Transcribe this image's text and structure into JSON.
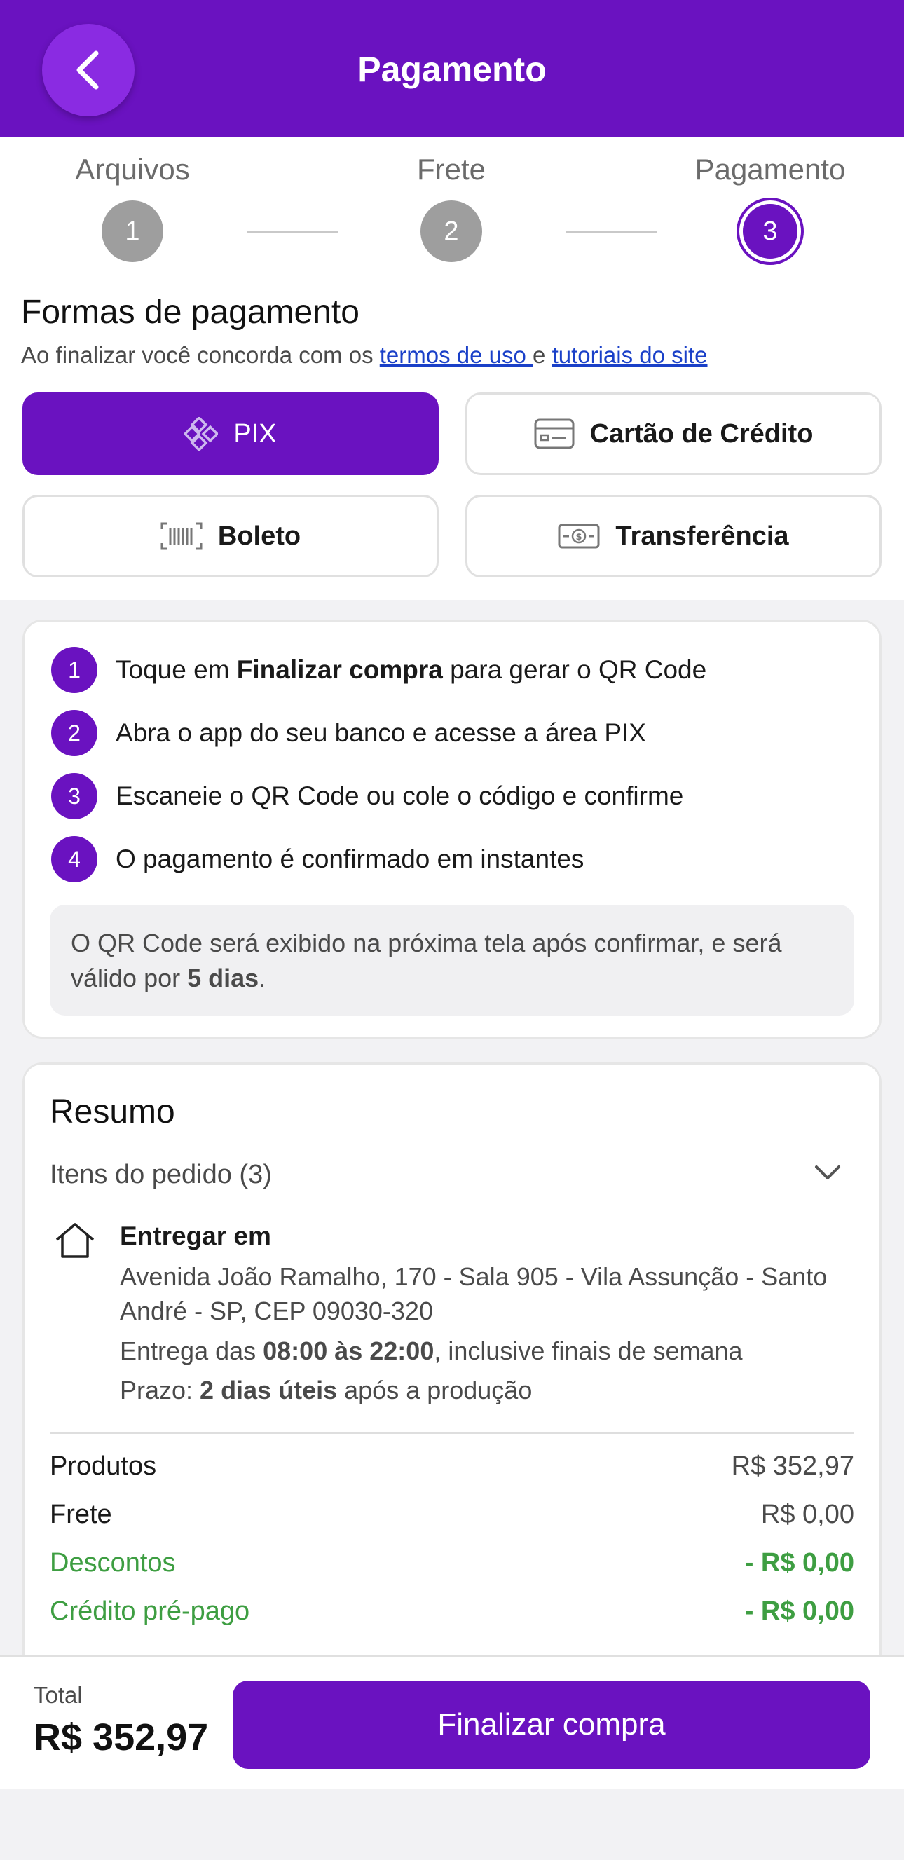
{
  "header": {
    "title": "Pagamento",
    "back_icon": "chevron-left-icon"
  },
  "steps": [
    {
      "label": "Arquivos",
      "number": "1",
      "active": false
    },
    {
      "label": "Frete",
      "number": "2",
      "active": false
    },
    {
      "label": "Pagamento",
      "number": "3",
      "active": true
    }
  ],
  "payment": {
    "title": "Formas de pagamento",
    "terms_prefix": "Ao finalizar você concorda com os ",
    "terms_link1": "termos de uso ",
    "terms_mid": "e ",
    "terms_link2": "tutoriais do site",
    "methods": [
      {
        "label": "PIX",
        "icon": "pix-icon",
        "selected": true
      },
      {
        "label": "Cartão de Crédito",
        "icon": "credit-card-icon",
        "selected": false
      },
      {
        "label": "Boleto",
        "icon": "barcode-icon",
        "selected": false
      },
      {
        "label": "Transferência",
        "icon": "money-transfer-icon",
        "selected": false
      }
    ]
  },
  "instructions": {
    "steps": [
      {
        "num": "1",
        "pre": "Toque em ",
        "bold": "Finalizar compra",
        "post": " para gerar o QR Code"
      },
      {
        "num": "2",
        "pre": "Abra o app do seu banco e acesse a área PIX",
        "bold": "",
        "post": ""
      },
      {
        "num": "3",
        "pre": "Escaneie o QR Code ou cole o código e confirme",
        "bold": "",
        "post": ""
      },
      {
        "num": "4",
        "pre": "O pagamento é confirmado em instantes",
        "bold": "",
        "post": ""
      }
    ],
    "note_pre": "O QR Code será exibido na próxima tela após confirmar, e será válido por ",
    "note_bold": "5 dias",
    "note_post": "."
  },
  "summary": {
    "title": "Resumo",
    "items_label": "Itens do pedido (3)",
    "deliver_title": "Entregar em",
    "address": "Avenida João Ramalho, 170 - Sala 905 - Vila Assunção - Santo André - SP, CEP 09030-320",
    "hours_pre": "Entrega das ",
    "hours_bold": "08:00 às 22:00",
    "hours_post": ", inclusive finais de semana",
    "deadline_pre": "Prazo: ",
    "deadline_bold": "2 dias úteis",
    "deadline_post": " após a produção",
    "rows": [
      {
        "label": "Produtos",
        "value": "R$ 352,97",
        "green": false
      },
      {
        "label": "Frete",
        "value": "R$ 0,00",
        "green": false
      },
      {
        "label": "Descontos",
        "value": "- R$ 0,00",
        "green": true
      },
      {
        "label": "Crédito pré-pago",
        "value": "- R$ 0,00",
        "green": true
      }
    ]
  },
  "footer": {
    "total_label": "Total",
    "total_value": "R$ 352,97",
    "finish_label": "Finalizar compra"
  },
  "colors": {
    "primary": "#6a12c0",
    "green": "#3e9e42",
    "link": "#1a40c8"
  }
}
